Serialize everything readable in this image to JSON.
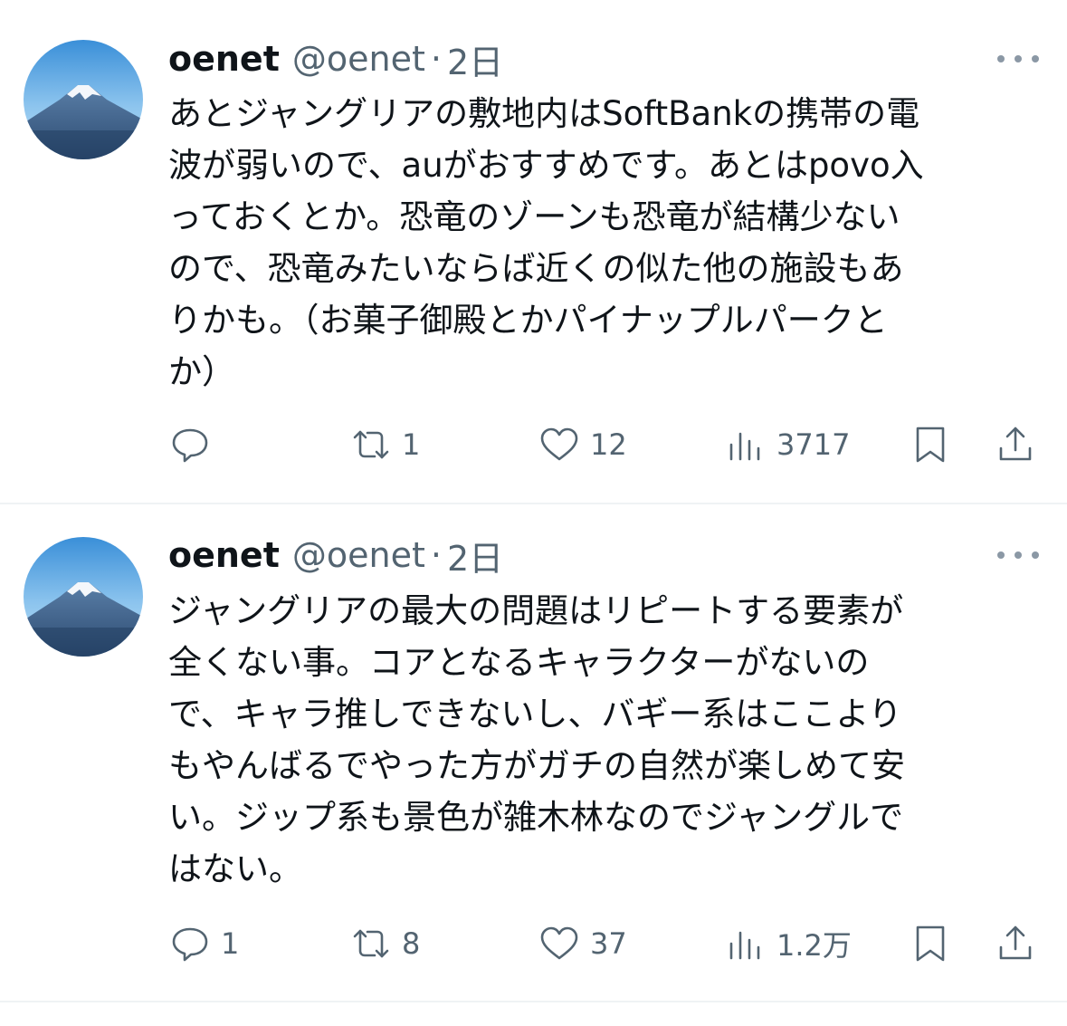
{
  "tweets": [
    {
      "name": "oenet",
      "handle": "@oenet",
      "separator": "·",
      "time": "2日",
      "text": "あとジャングリアの敷地内はSoftBankの携帯の電\n波が弱いので、auがおすすめです。あとはpovo入\nっておくとか。恐竜のゾーンも恐竜が結構少ない\nので、恐竜みたいならば近くの似た他の施設もあ\nりかも。（お菓子御殿とかパイナップルパークと\nか）",
      "replies": "",
      "retweets": "1",
      "likes": "12",
      "views": "3717"
    },
    {
      "name": "oenet",
      "handle": "@oenet",
      "separator": "·",
      "time": "2日",
      "text": "ジャングリアの最大の問題はリピートする要素が\n全くない事。コアとなるキャラクターがないの\nで、キャラ推しできないし、バギー系はここより\nもやんばるでやった方がガチの自然が楽しめて安\nい。ジップ系も景色が雑木林なのでジャングルで\nはない。",
      "replies": "1",
      "retweets": "8",
      "likes": "37",
      "views": "1.2万"
    }
  ],
  "icons": {
    "reply": "reply-icon",
    "retweet": "retweet-icon",
    "like": "heart-icon",
    "views": "views-icon",
    "bookmark": "bookmark-icon",
    "share": "share-icon",
    "more": "more-icon"
  },
  "colors": {
    "text": "#0f1419",
    "secondary": "#536471",
    "divider": "#eff3f4"
  }
}
